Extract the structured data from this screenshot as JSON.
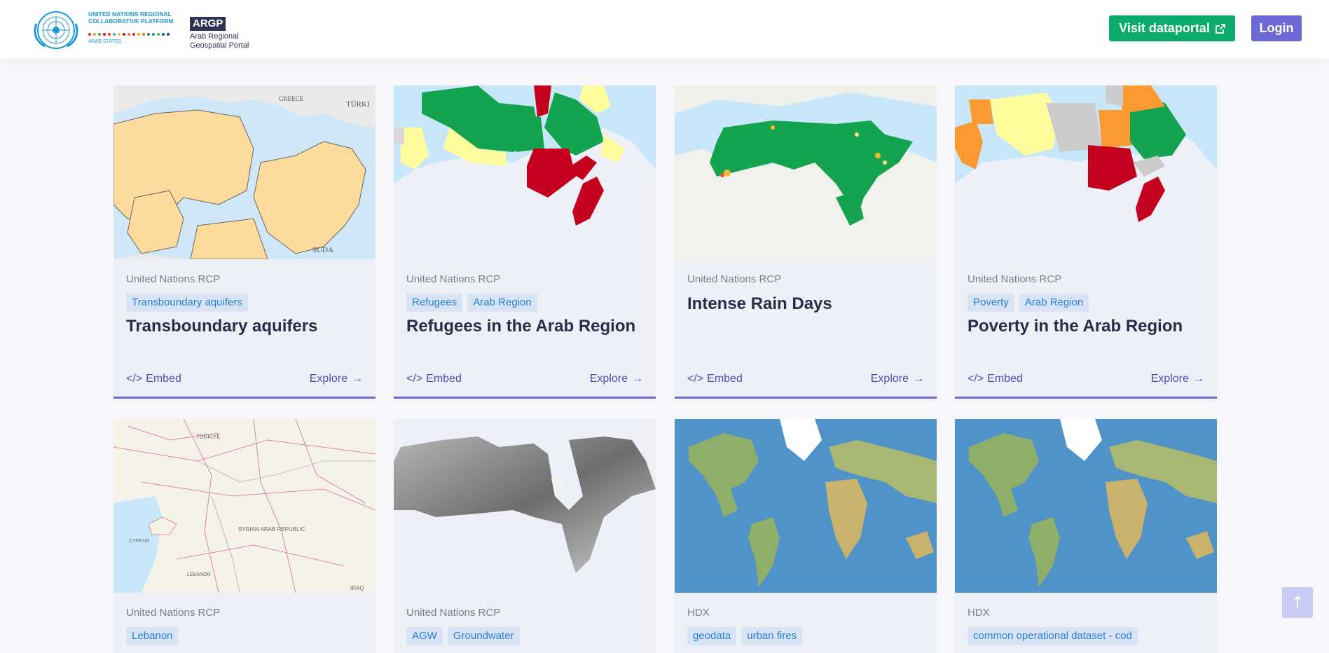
{
  "header": {
    "un_logo_text": "UNITED NATIONS REGIONAL COLLABORATIVE PLATFORM",
    "un_logo_sub": "ARAB STATES",
    "argp_badge": "ARGP",
    "argp_name_line1": "Arab Regional",
    "argp_name_line2": "Geospatial Portal",
    "dataportal_label": "Visit dataportal",
    "login_label": "Login"
  },
  "cards": [
    {
      "source": "United Nations RCP",
      "tags": [
        "Transboundary aquifers"
      ],
      "title": "Transboundary aquifers",
      "embed": "Embed",
      "explore": "Explore"
    },
    {
      "source": "United Nations RCP",
      "tags": [
        "Refugees",
        "Arab Region"
      ],
      "title": "Refugees in the Arab Region",
      "embed": "Embed",
      "explore": "Explore"
    },
    {
      "source": "United Nations RCP",
      "tags": [],
      "title": "Intense Rain Days",
      "embed": "Embed",
      "explore": "Explore"
    },
    {
      "source": "United Nations RCP",
      "tags": [
        "Poverty",
        "Arab Region"
      ],
      "title": "Poverty in the Arab Region",
      "embed": "Embed",
      "explore": "Explore"
    },
    {
      "source": "United Nations RCP",
      "tags": [
        "Lebanon"
      ],
      "title": "",
      "embed": "",
      "explore": ""
    },
    {
      "source": "United Nations RCP",
      "tags": [
        "AGW",
        "Groundwater"
      ],
      "title": "",
      "embed": "",
      "explore": ""
    },
    {
      "source": "HDX",
      "tags": [
        "geodata",
        "urban fires"
      ],
      "title": "",
      "embed": "",
      "explore": ""
    },
    {
      "source": "HDX",
      "tags": [
        "common operational dataset - cod"
      ],
      "title": "",
      "embed": "",
      "explore": ""
    }
  ],
  "map_labels": {
    "greece": "GREECE",
    "turkey_partial": "TÜRKI",
    "sudan_partial": "SUDA",
    "turkiye": "TÜRKIYE",
    "cyprus": "CYPRUS",
    "syria": "SYRIAN ARAB REPUBLIC",
    "lebanon": "LEBANON",
    "iraq": "IRAQ"
  },
  "colors": {
    "accent": "#6c69d6",
    "green_button": "#0bab6b",
    "tag_bg": "#d8e4f6",
    "tag_text": "#2a7fd4",
    "card_bg": "#eef0f8"
  },
  "icons": {
    "external_link": "external-link-icon",
    "embed": "code-icon",
    "explore": "arrow-right-icon",
    "scroll_top": "arrow-up-icon"
  }
}
